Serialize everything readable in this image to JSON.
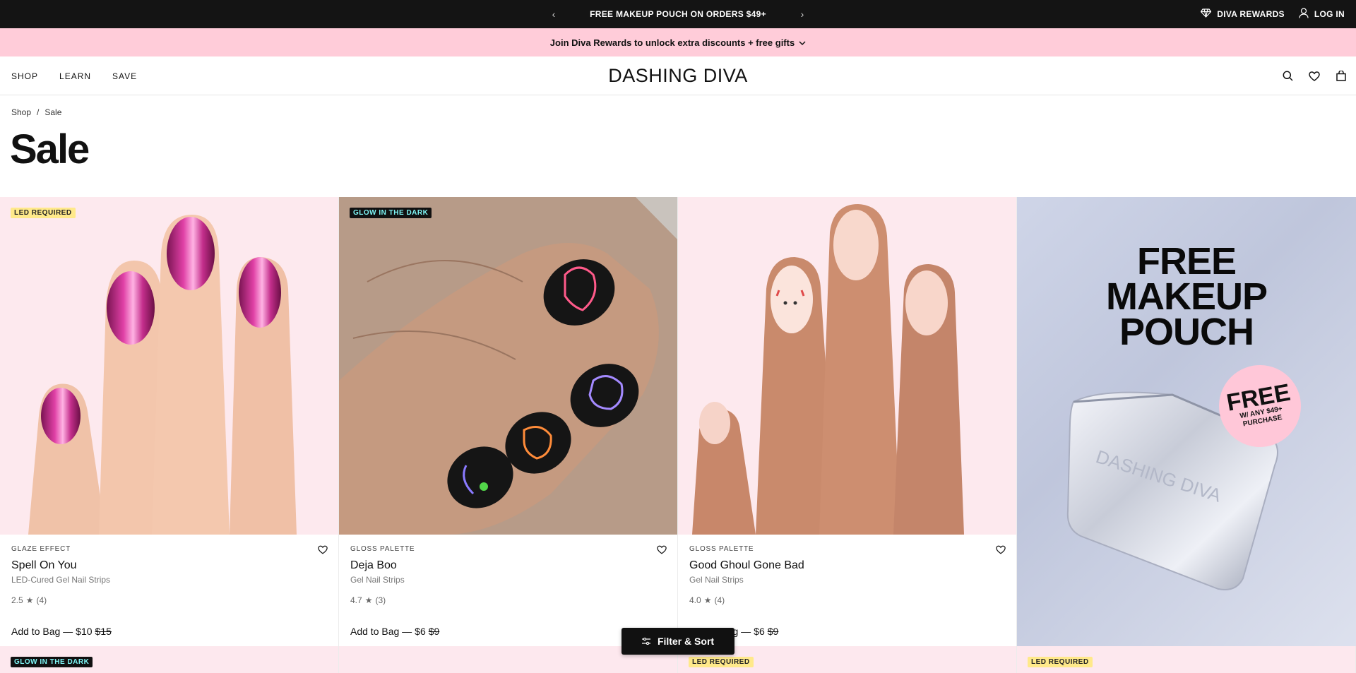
{
  "topbar": {
    "promo_message": "FREE MAKEUP POUCH ON ORDERS $49+",
    "prev_icon": "chevron-left-icon",
    "next_icon": "chevron-right-icon",
    "rewards_label": "DIVA REWARDS",
    "login_label": "LOG IN"
  },
  "rewards_banner": {
    "text": "Join Diva Rewards to unlock extra discounts + free gifts"
  },
  "header": {
    "nav": [
      "SHOP",
      "LEARN",
      "SAVE"
    ],
    "logo": "DASHING DIVA",
    "icons": [
      "search-icon",
      "heart-icon",
      "bag-icon"
    ]
  },
  "breadcrumb": {
    "items": [
      "Shop",
      "Sale"
    ],
    "separator": "/"
  },
  "page": {
    "title": "Sale"
  },
  "products": [
    {
      "badge": "LED REQUIRED",
      "category": "GLAZE EFFECT",
      "name": "Spell On You",
      "type": "LED-Cured Gel Nail Strips",
      "rating": "2.5",
      "reviews": "(4)",
      "add_label": "Add to Bag —",
      "price": "$10",
      "old_price": "$15"
    },
    {
      "badge": "GLOW IN THE DARK",
      "category": "GLOSS PALETTE",
      "name": "Deja Boo",
      "type": "Gel Nail Strips",
      "rating": "4.7",
      "reviews": "(3)",
      "add_label": "Add to Bag —",
      "price": "$6",
      "old_price": "$9"
    },
    {
      "badge": "",
      "category": "GLOSS PALETTE",
      "name": "Good Ghoul Gone Bad",
      "type": "Gel Nail Strips",
      "rating": "4.0",
      "reviews": "(4)",
      "add_label": "Add to Bag —",
      "price": "$6",
      "old_price": "$9"
    }
  ],
  "promo_tile": {
    "headline_lines": [
      "FREE",
      "MAKEUP",
      "POUCH"
    ],
    "circle_big": "FREE",
    "circle_small": "W/ ANY $49+ PURCHASE",
    "pouch_text": "DASHING DIVA"
  },
  "next_row_badges": [
    "GLOW IN THE DARK",
    "",
    "LED REQUIRED",
    "LED REQUIRED"
  ],
  "filter_button": {
    "label": "Filter & Sort",
    "icon": "sliders-icon"
  },
  "colors": {
    "topbar": "#141414",
    "rewards_banner": "#ffccd9",
    "led_badge": "#ffe98a",
    "glow_badge_text": "#7ef6f6"
  }
}
